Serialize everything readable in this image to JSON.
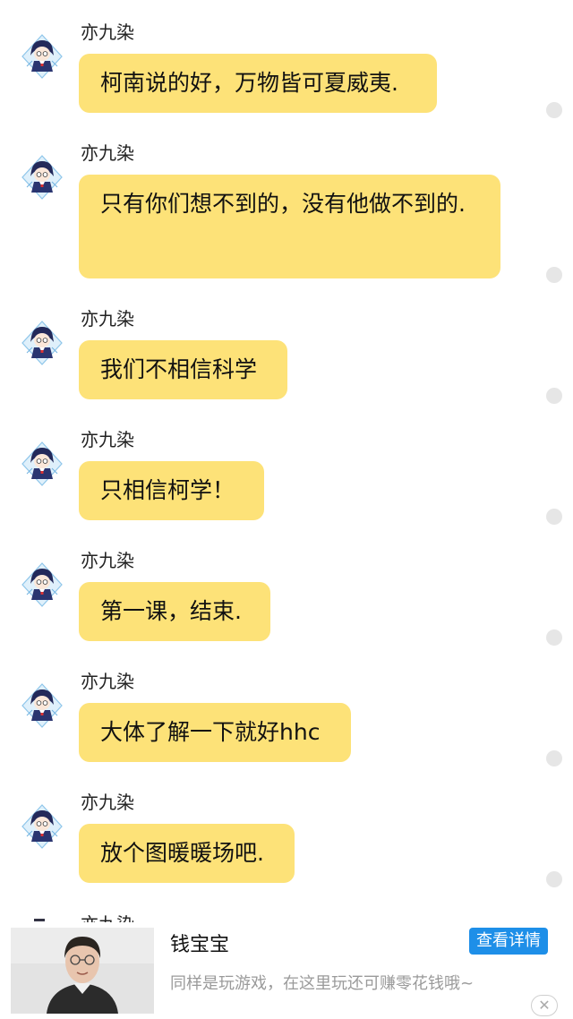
{
  "messages": [
    {
      "sender": "亦九染",
      "text": "柯南说的好，万物皆可夏威夷."
    },
    {
      "sender": "亦九染",
      "text": "只有你们想不到的，没有他做不到的."
    },
    {
      "sender": "亦九染",
      "text": "我们不相信科学"
    },
    {
      "sender": "亦九染",
      "text": "只相信柯学！"
    },
    {
      "sender": "亦九染",
      "text": "第一课，结束."
    },
    {
      "sender": "亦九染",
      "text": "大体了解一下就好hhc"
    },
    {
      "sender": "亦九染",
      "text": "放个图暖暖场吧."
    }
  ],
  "partial_sender": "亦九染",
  "ad": {
    "title": "钱宝宝",
    "button": "查看详情",
    "description": "同样是玩游戏，在这里玩还可赚零花钱哦~",
    "close_icon": "close-icon"
  },
  "colors": {
    "bubble": "#fde278",
    "ad_button": "#1e8fe8"
  }
}
